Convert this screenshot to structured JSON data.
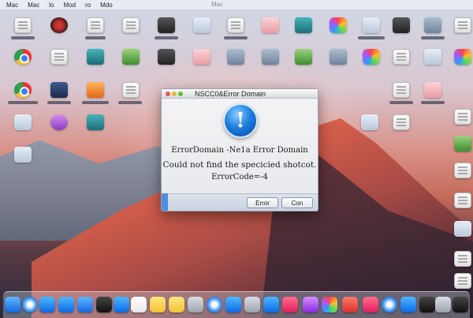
{
  "menubar": {
    "items": [
      "Mac",
      "Mac",
      "lo",
      "Mod",
      "ro",
      "Mdo"
    ],
    "title": "Mac"
  },
  "dialog": {
    "title": "NSCC0&Error Domain",
    "alert_glyph": "!",
    "line1": "ErrorDomain -Ne1a Error Domain",
    "line2": "Could not find the specicied shotcot.",
    "line3": "ErrorCode=-4",
    "button1": "Error",
    "button2": "Con"
  },
  "colors": {
    "alert_blue": "#1e7fe0",
    "close": "#e9574e",
    "minimize": "#e4b93a",
    "zoom": "#5ac13c",
    "footer_accent": "#4a8fe0"
  }
}
